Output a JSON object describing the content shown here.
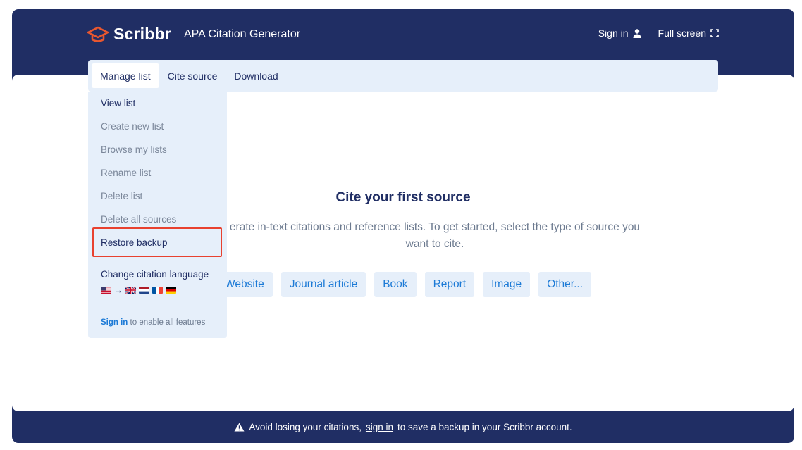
{
  "header": {
    "logo_text": "Scribbr",
    "app_title": "APA Citation Generator",
    "sign_in_label": "Sign in",
    "full_screen_label": "Full screen"
  },
  "toolbar": {
    "tabs": [
      {
        "label": "Manage list",
        "active": true
      },
      {
        "label": "Cite source",
        "active": false
      },
      {
        "label": "Download",
        "active": false
      }
    ]
  },
  "dropdown": {
    "items": [
      {
        "label": "View list",
        "enabled": true
      },
      {
        "label": "Create new list",
        "enabled": false
      },
      {
        "label": "Browse my lists",
        "enabled": false
      },
      {
        "label": "Rename list",
        "enabled": false
      },
      {
        "label": "Delete list",
        "enabled": false
      },
      {
        "label": "Delete all sources",
        "enabled": false
      },
      {
        "label": "Restore backup",
        "enabled": true,
        "highlighted": true
      }
    ],
    "language_title": "Change citation language",
    "languages": [
      "us-flag-icon",
      "arrow-right-icon",
      "uk-flag-icon",
      "nl-flag-icon",
      "fr-flag-icon",
      "de-flag-icon"
    ],
    "sign_in_link": "Sign in",
    "sign_in_suffix": "to enable all features"
  },
  "main": {
    "title": "Cite your first source",
    "description_visible": "erate in-text citations and reference lists. To get started, select the type of source you want to cite.",
    "source_types": [
      "Website",
      "Journal article",
      "Book",
      "Report",
      "Image",
      "Other..."
    ]
  },
  "footer": {
    "prefix": "Avoid losing your citations,",
    "link": "sign in",
    "suffix": "to save a backup in your Scribbr account."
  },
  "colors": {
    "navy": "#202e64",
    "accent_blue": "#1c7ad6",
    "panel_bg": "#e6effa",
    "highlight_red": "#e8412f",
    "logo_orange": "#e8572f"
  }
}
